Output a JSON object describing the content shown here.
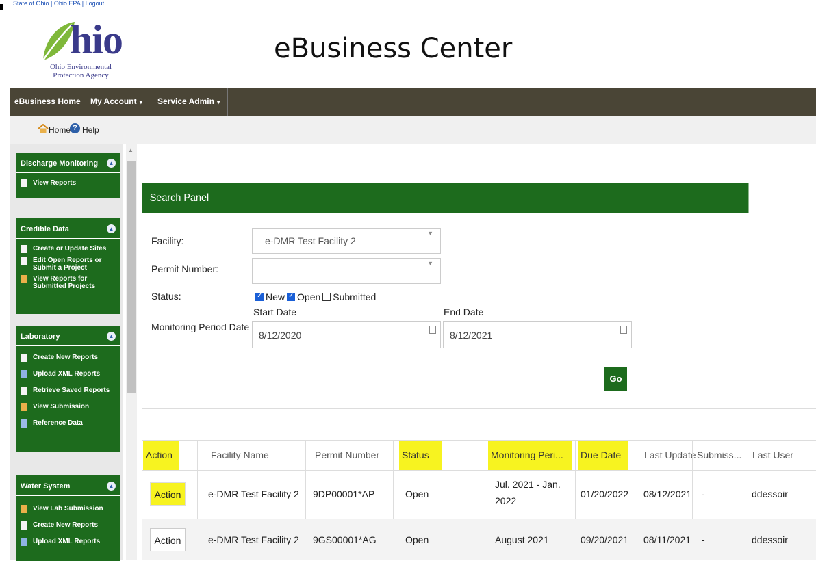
{
  "top_links": {
    "state": "State of Ohio",
    "sep1": " | ",
    "epa": "Ohio EPA",
    "sep2": " | ",
    "logout": "Logout"
  },
  "logo": {
    "word": "hio",
    "line1": "Ohio Environmental",
    "line2": "Protection Agency"
  },
  "page_title": "eBusiness Center",
  "navbar": {
    "home": "eBusiness Home",
    "account": "My Account",
    "admin": "Service Admin",
    "caret": "▾"
  },
  "subbar": {
    "home": "Home",
    "help": "Help"
  },
  "sidebar": {
    "discharge": {
      "title": "Discharge Monitoring",
      "items": [
        "View Reports"
      ]
    },
    "credible": {
      "title": "Credible Data",
      "items": [
        "Create or Update Sites",
        "Edit Open Reports or Submit a Project",
        "View Reports for Submitted Projects"
      ]
    },
    "lab": {
      "title": "Laboratory",
      "items": [
        "Create New Reports",
        "Upload XML Reports",
        "Retrieve Saved Reports",
        "View Submission",
        "Reference Data"
      ]
    },
    "water": {
      "title": "Water System",
      "items": [
        "View Lab Submission",
        "Create New Reports",
        "Upload XML Reports"
      ]
    }
  },
  "search": {
    "title": "Search Panel",
    "facility_label": "Facility:",
    "facility_value": "e-DMR Test Facility 2",
    "permit_label": "Permit Number:",
    "permit_value": "",
    "status_label": "Status:",
    "status_options": [
      {
        "label": "New",
        "checked": true
      },
      {
        "label": "Open",
        "checked": true
      },
      {
        "label": "Submitted",
        "checked": false
      }
    ],
    "period_label": "Monitoring Period Date :",
    "start_label": "Start Date",
    "start_value": "8/12/2020",
    "end_label": "End Date",
    "end_value": "8/12/2021",
    "go": "Go"
  },
  "grid": {
    "columns": [
      "Action",
      "Facility Name",
      "Permit Number",
      "Status",
      "Monitoring Peri...",
      "Due Date",
      "Last Update",
      "Submiss...",
      "Last User"
    ],
    "highlighted_columns": [
      "Action",
      "Status",
      "Monitoring Peri...",
      "Due Date"
    ],
    "rows": [
      {
        "action": "Action",
        "facility": "e-DMR Test Facility 2",
        "permit": "9DP00001*AP",
        "status": "Open",
        "period_line1": "Jul. 2021 - Jan.",
        "period_line2": "2022",
        "due": "01/20/2022",
        "updated": "08/12/2021",
        "submission": "-",
        "user": "ddessoir"
      },
      {
        "action": "Action",
        "facility": "e-DMR Test Facility 2",
        "permit": "9GS00001*AG",
        "status": "Open",
        "period_line1": "August 2021",
        "period_line2": "",
        "due": "09/20/2021",
        "updated": "08/11/2021",
        "submission": "-",
        "user": "ddessoir"
      }
    ]
  },
  "colors": {
    "green": "#1d6b1d",
    "nav": "#4a4536",
    "highlight": "#f7f320",
    "link": "#1a4fb5"
  }
}
